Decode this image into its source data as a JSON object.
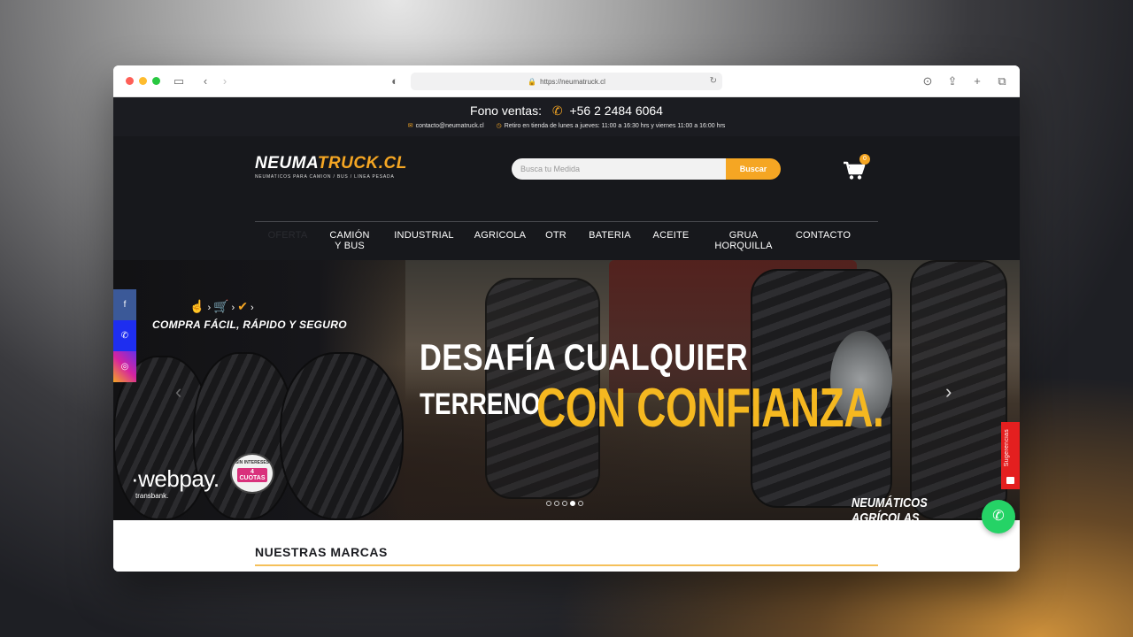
{
  "browser": {
    "url": "https://neumatruck.cl"
  },
  "topbar": {
    "fono_label": "Fono ventas:",
    "phone": "+56 2 2484 6064",
    "email": "contacto@neumatruck.cl",
    "hours": "Retiro en tienda de lunes a jueves: 11:00 a 16:30 hrs y viernes 11:00 a 16:00 hrs"
  },
  "logo": {
    "main_a": "NEUMA",
    "main_b": "TRUCK.CL",
    "sub": "NEUMATICOS PARA CAMION / BUS / LINEA PESADA"
  },
  "search": {
    "placeholder": "Busca tu Medida",
    "button": "Buscar"
  },
  "cart": {
    "count": "0"
  },
  "nav": {
    "items": [
      "OFERTA",
      "CAMIÓN\nY BUS",
      "INDUSTRIAL",
      "AGRICOLA",
      "OTR",
      "BATERIA",
      "ACEITE",
      "GRUA\nHORQUILLA",
      "CONTACTO"
    ]
  },
  "hero": {
    "compra": "COMPRA FÁCIL, RÁPIDO Y SEGURO",
    "headline1": "DESAFÍA CUALQUIER",
    "headline2a": "TERRENO",
    "headline2b": "CON CONFIANZA.",
    "webpay": "·webpay.",
    "transbank": "transbank.",
    "badge_top": "SIN INTERESES",
    "badge_cuotas": "4 CUOTAS",
    "category": "NEUMÁTICOS AGRÍCOLAS",
    "slides": 5,
    "active_slide": 4
  },
  "floating": {
    "sugerencias": "Sugerencias"
  },
  "marcas": {
    "title": "NUESTRAS MARCAS"
  },
  "colors": {
    "accent": "#f5a623",
    "dark": "#17181c",
    "whatsapp": "#25d366",
    "sugerencias": "#e41f1f"
  }
}
